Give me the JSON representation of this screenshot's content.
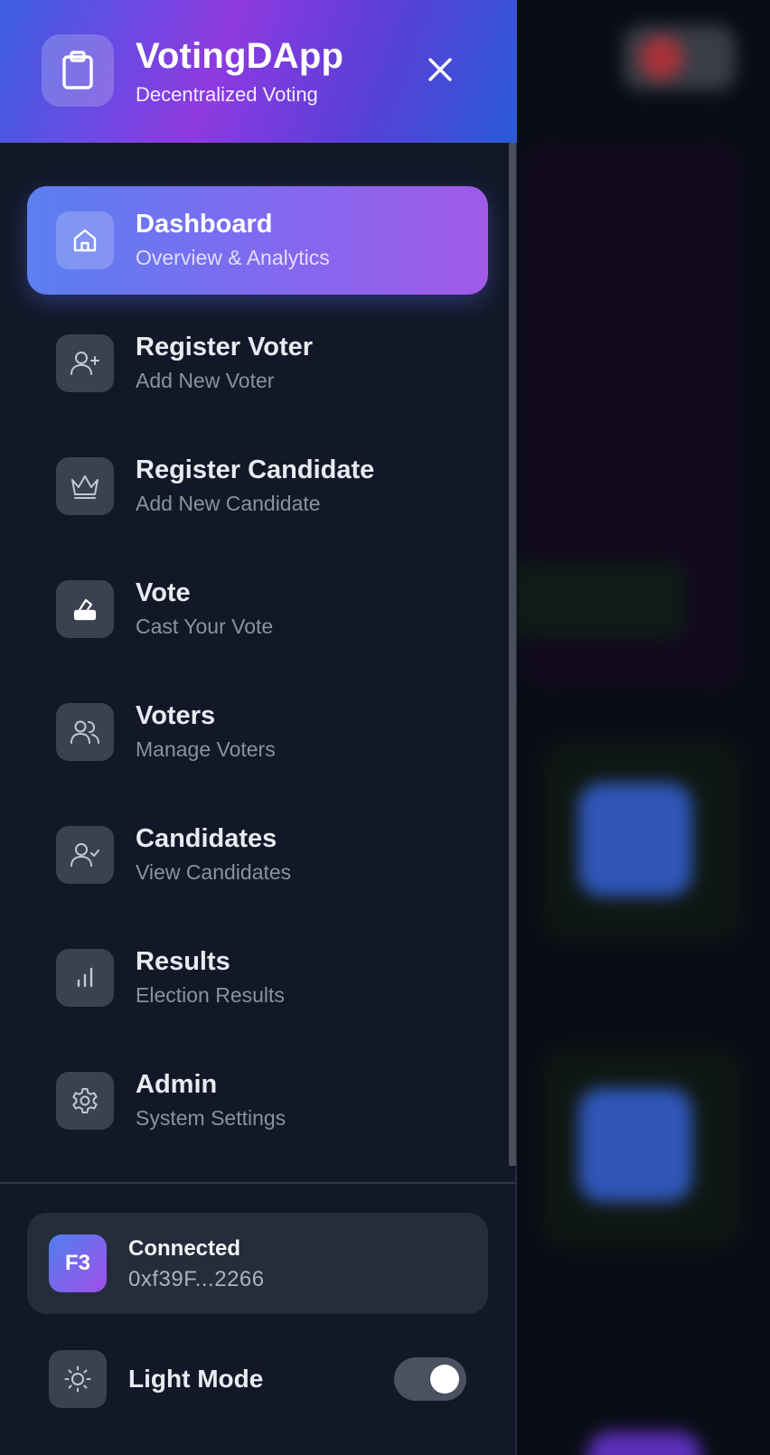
{
  "app": {
    "title": "VotingDApp",
    "subtitle": "Decentralized Voting"
  },
  "nav": {
    "items": [
      {
        "label": "Dashboard",
        "sub": "Overview & Analytics",
        "icon": "home-icon",
        "active": true
      },
      {
        "label": "Register Voter",
        "sub": "Add New Voter",
        "icon": "user-plus-icon",
        "active": false
      },
      {
        "label": "Register Candidate",
        "sub": "Add New Candidate",
        "icon": "crown-icon",
        "active": false
      },
      {
        "label": "Vote",
        "sub": "Cast Your Vote",
        "icon": "ballot-icon",
        "active": false
      },
      {
        "label": "Voters",
        "sub": "Manage Voters",
        "icon": "users-icon",
        "active": false
      },
      {
        "label": "Candidates",
        "sub": "View Candidates",
        "icon": "user-check-icon",
        "active": false
      },
      {
        "label": "Results",
        "sub": "Election Results",
        "icon": "bar-chart-icon",
        "active": false
      },
      {
        "label": "Admin",
        "sub": "System Settings",
        "icon": "gear-icon",
        "active": false
      }
    ]
  },
  "wallet": {
    "avatar_text": "F3",
    "status": "Connected",
    "address": "0xf39F...2266"
  },
  "theme": {
    "label": "Light Mode",
    "toggle_on": true
  },
  "colors": {
    "header_gradient": [
      "#3c5fe3",
      "#8e3ae0",
      "#2a5bd6"
    ],
    "active_gradient": [
      "#5b80f0",
      "#a05ae8"
    ],
    "sidebar_bg": "#121827"
  }
}
